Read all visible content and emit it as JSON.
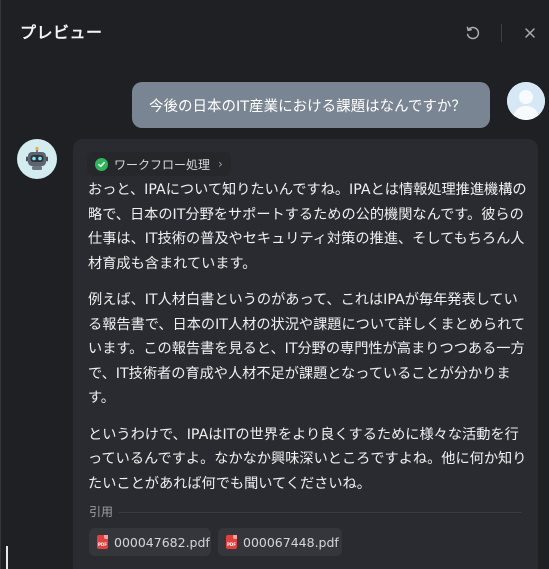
{
  "header": {
    "title": "プレビュー"
  },
  "user_message": {
    "text": "今後の日本のIT産業における課題はなんですか？"
  },
  "bot_message": {
    "workflow_label": "ワークフロー処理",
    "paragraphs": [
      "おっと、IPAについて知りたいんですね。IPAとは情報処理推進機構の略で、日本のIT分野をサポートするための公的機関なんです。彼らの仕事は、IT技術の普及やセキュリティ対策の推進、そしてもちろん人材育成も含まれています。",
      "例えば、IT人材白書というのがあって、これはIPAが毎年発表している報告書で、日本のIT人材の状況や課題について詳しくまとめられています。この報告書を見ると、IT分野の専門性が高まりつつある一方で、IT技術者の育成や人材不足が課題となっていることが分かります。",
      "というわけで、IPAはITの世界をより良くするために様々な活動を行っているんですよ。なかなか興味深いところですよね。他に何か知りたいことがあれば何でも聞いてくださいね。"
    ],
    "citation_label": "引用",
    "files": [
      {
        "name": "000047682.pdf",
        "icon": "pdf-icon"
      },
      {
        "name": "000067448.pdf",
        "icon": "pdf-icon"
      }
    ]
  },
  "icons": {
    "refresh": "refresh-icon",
    "close": "close-icon",
    "bot_avatar": "robot-icon",
    "user_avatar": "user-avatar-icon",
    "workflow_status": "check-circle-icon",
    "workflow_expand": "chevron-right-icon"
  },
  "colors": {
    "background": "#1f2024",
    "user_bubble": "#7a8593",
    "bot_bubble": "#2a2b30",
    "success": "#2fb45a",
    "pdf": "#e0413f"
  }
}
